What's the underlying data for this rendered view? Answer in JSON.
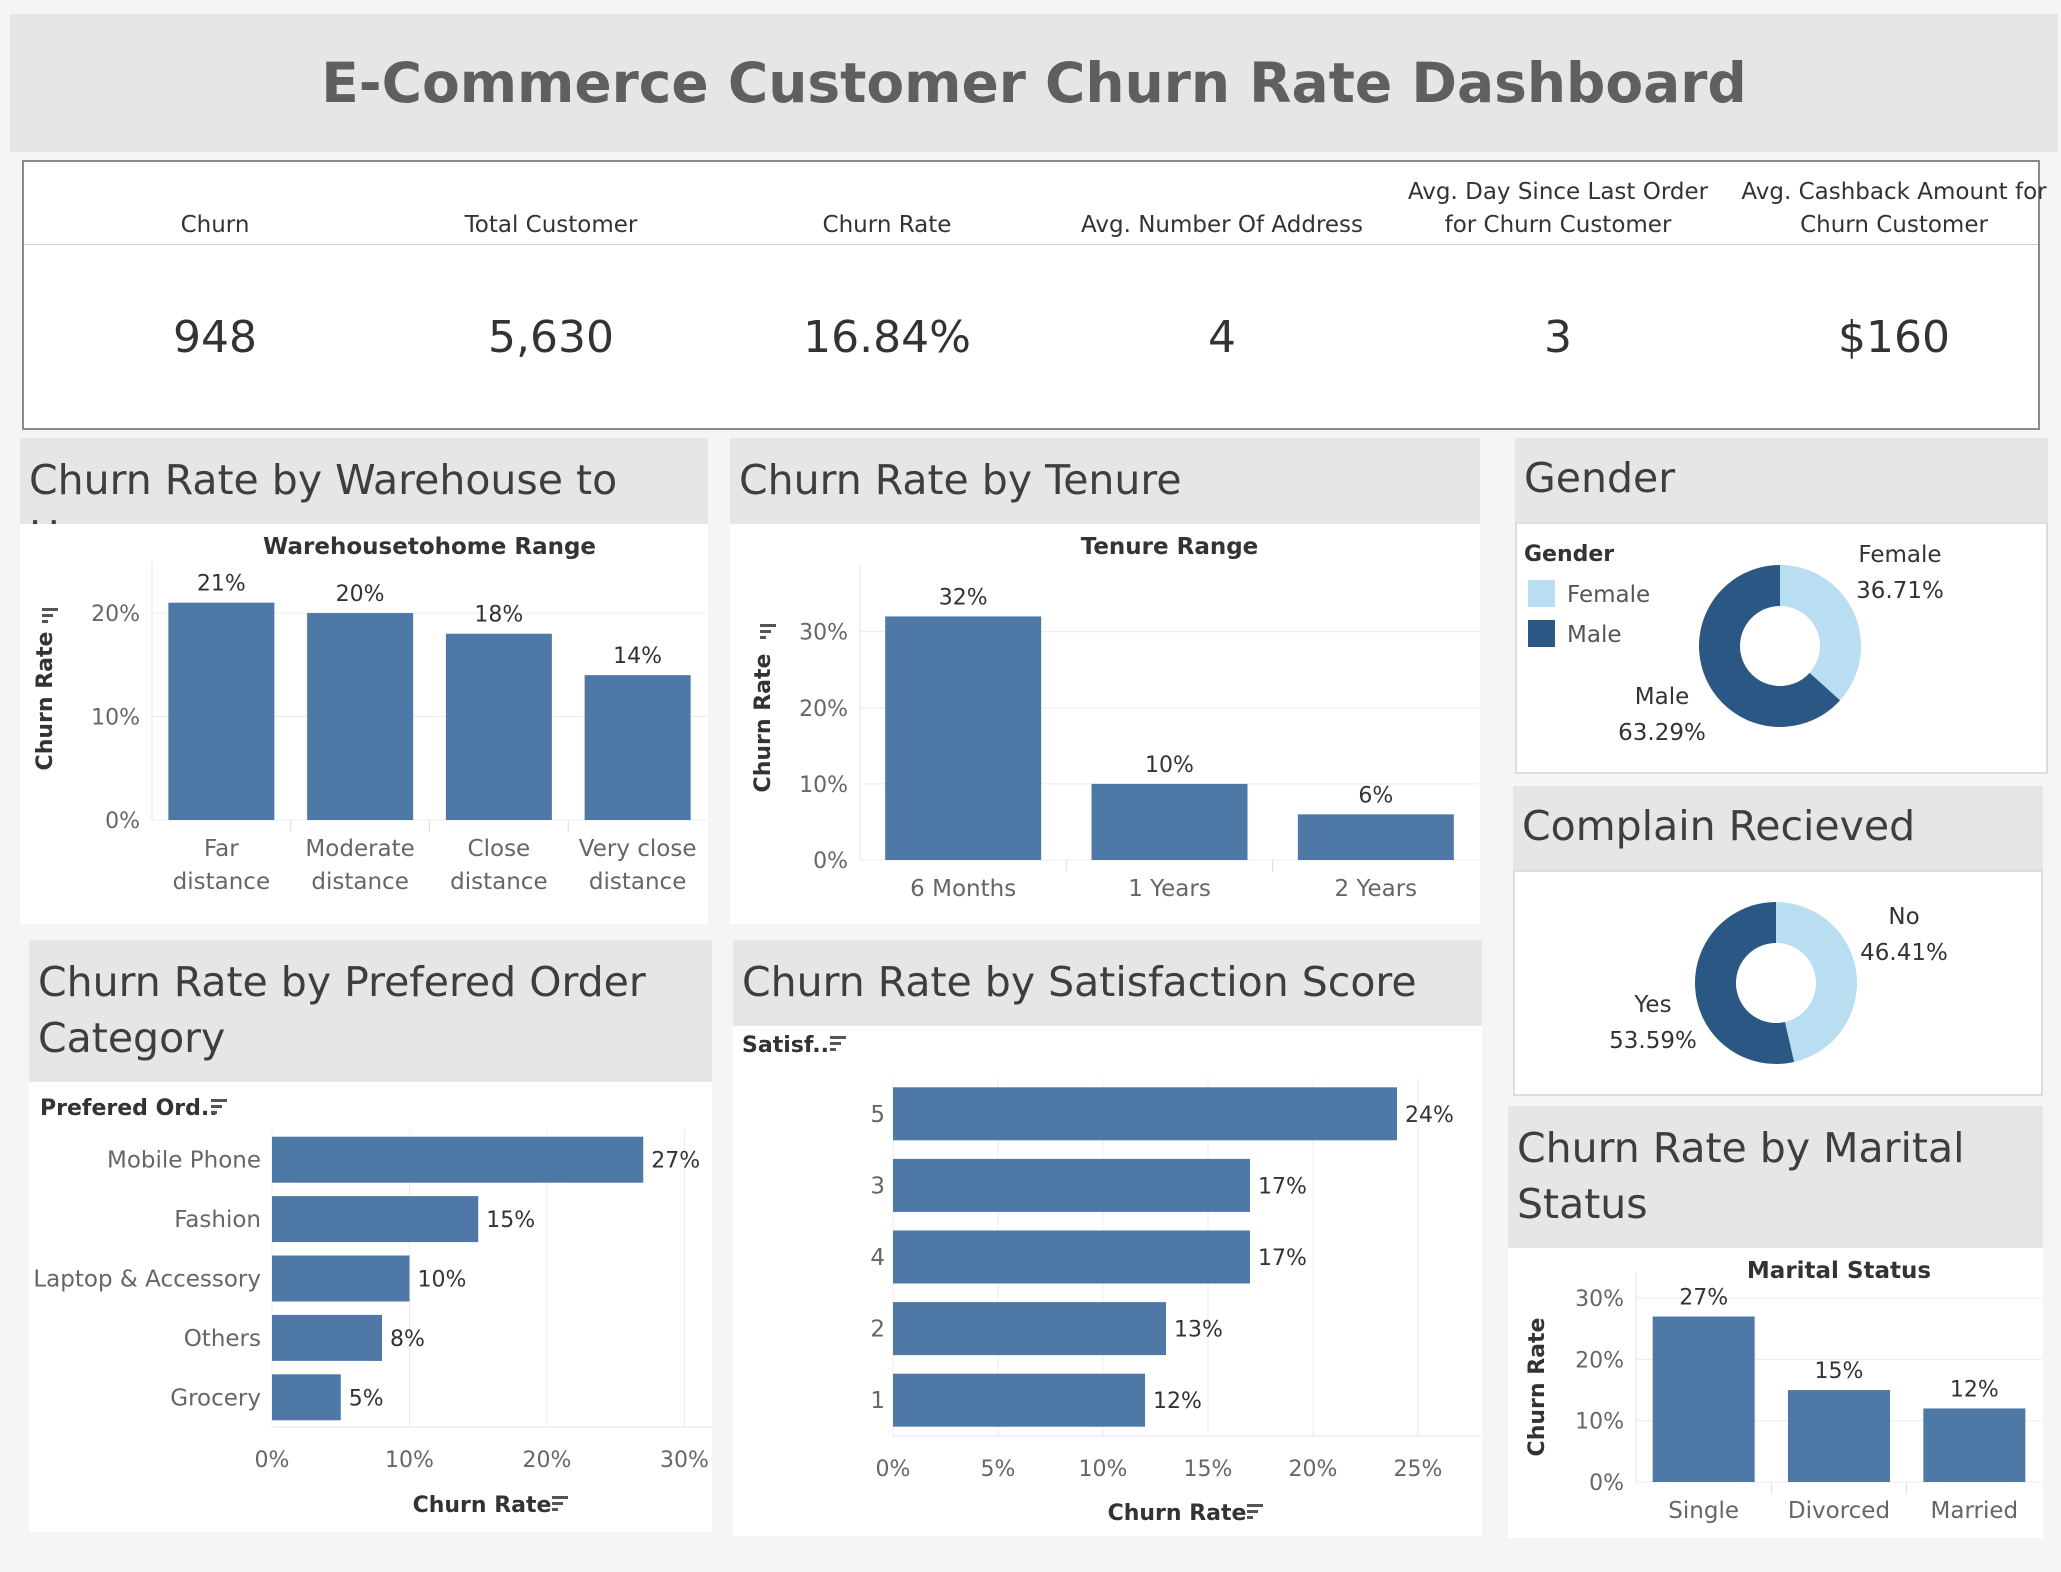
{
  "title": "E-Commerce Customer Churn Rate Dashboard",
  "kpis": [
    {
      "label": "Churn",
      "value": "948"
    },
    {
      "label": "Total Customer",
      "value": "5,630"
    },
    {
      "label": "Churn Rate",
      "value": "16.84%"
    },
    {
      "label": "Avg. Number Of Address",
      "value": "4"
    },
    {
      "label": "Avg. Day Since Last Order\nfor Churn Customer",
      "value": "3"
    },
    {
      "label": "Avg. Cashback Amount for\nChurn Customer",
      "value": "$160"
    }
  ],
  "sections": {
    "warehouse": "Churn Rate by Warehouse to Home",
    "tenure": "Churn Rate by Tenure",
    "gender": "Gender",
    "complain": "Complain Recieved",
    "order_category": "Churn Rate by Prefered Order Category",
    "satisfaction": "Churn Rate by Satisfaction Score",
    "marital": "Churn Rate by Marital Status"
  },
  "chart_data": [
    {
      "id": "warehouse",
      "type": "bar",
      "title": "Warehousetohome Range",
      "ylabel": "Churn Rate",
      "categories": [
        "Far distance",
        "Moderate distance",
        "Close distance",
        "Very close distance"
      ],
      "values": [
        21,
        20,
        18,
        14
      ],
      "data_labels": [
        "21%",
        "20%",
        "18%",
        "14%"
      ],
      "yticks": [
        "0%",
        "10%",
        "20%"
      ],
      "ylim": [
        0,
        23
      ],
      "color": "#4e79a7"
    },
    {
      "id": "tenure",
      "type": "bar",
      "title": "Tenure Range",
      "ylabel": "Churn Rate",
      "categories": [
        "6 Months",
        "1 Years",
        "2 Years"
      ],
      "values": [
        32,
        10,
        6
      ],
      "data_labels": [
        "32%",
        "10%",
        "6%"
      ],
      "yticks": [
        "0%",
        "10%",
        "20%",
        "30%"
      ],
      "ylim": [
        0,
        36
      ],
      "color": "#4e79a7"
    },
    {
      "id": "gender",
      "type": "pie",
      "legend_title": "Gender",
      "labels": [
        "Female",
        "Male"
      ],
      "values": [
        36.71,
        63.29
      ],
      "data_labels": [
        "36.71%",
        "63.29%"
      ],
      "colors": [
        "#b9ddf1",
        "#2a5783"
      ]
    },
    {
      "id": "complain",
      "type": "pie",
      "labels": [
        "No",
        "Yes"
      ],
      "values": [
        46.41,
        53.59
      ],
      "data_labels": [
        "46.41%",
        "53.59%"
      ],
      "colors": [
        "#b9ddf1",
        "#2a5783"
      ]
    },
    {
      "id": "order_category",
      "type": "bar",
      "orientation": "horizontal",
      "field_label": "Prefered Ord..",
      "xlabel": "Churn Rate",
      "categories": [
        "Mobile Phone",
        "Fashion",
        "Laptop & Accessory",
        "Others",
        "Grocery"
      ],
      "values": [
        27,
        15,
        10,
        8,
        5
      ],
      "data_labels": [
        "27%",
        "15%",
        "10%",
        "8%",
        "5%"
      ],
      "xticks": [
        "0%",
        "10%",
        "20%",
        "30%"
      ],
      "xlim": [
        0,
        32
      ],
      "color": "#4e79a7"
    },
    {
      "id": "satisfaction",
      "type": "bar",
      "orientation": "horizontal",
      "field_label": "Satisf..",
      "xlabel": "Churn Rate",
      "categories": [
        "5",
        "3",
        "4",
        "2",
        "1"
      ],
      "values": [
        24,
        17,
        17,
        13,
        12
      ],
      "data_labels": [
        "24%",
        "17%",
        "17%",
        "13%",
        "12%"
      ],
      "xticks": [
        "0%",
        "5%",
        "10%",
        "15%",
        "20%",
        "25%"
      ],
      "xlim": [
        0,
        28
      ],
      "color": "#4e79a7"
    },
    {
      "id": "marital",
      "type": "bar",
      "title": "Marital Status",
      "ylabel": "Churn Rate",
      "categories": [
        "Single",
        "Divorced",
        "Married"
      ],
      "values": [
        27,
        15,
        12
      ],
      "data_labels": [
        "27%",
        "15%",
        "12%"
      ],
      "yticks": [
        "0%",
        "10%",
        "20%",
        "30%"
      ],
      "ylim": [
        0,
        31
      ],
      "color": "#4e79a7"
    }
  ]
}
